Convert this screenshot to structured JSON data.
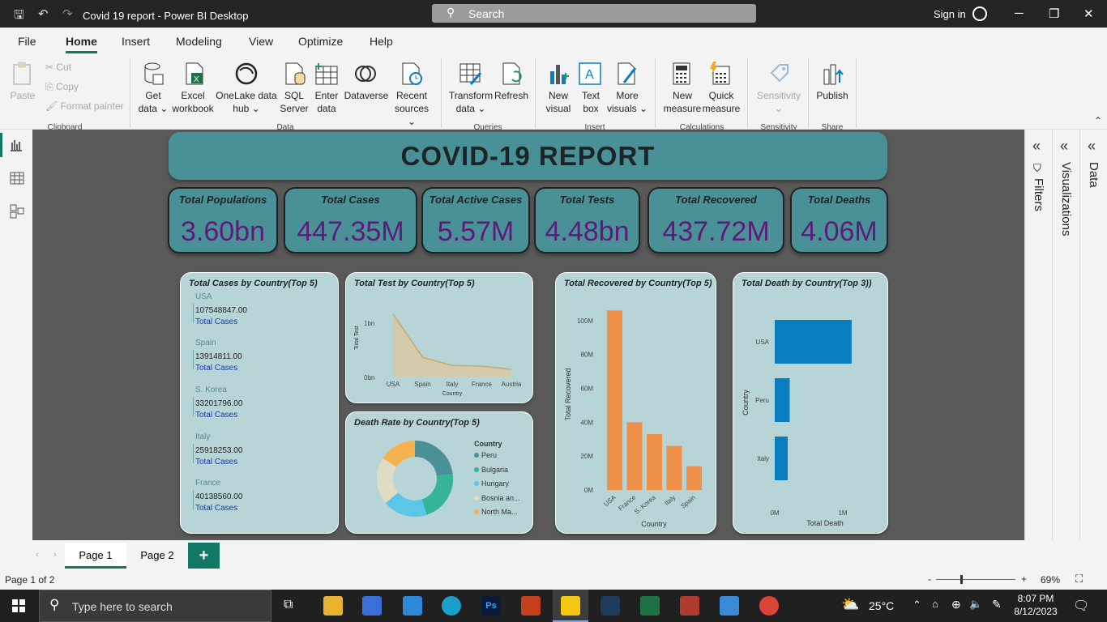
{
  "titlebar": {
    "title": "Covid 19 report - Power BI Desktop",
    "search": "Search",
    "signin": "Sign in"
  },
  "menu": {
    "file": "File",
    "home": "Home",
    "insert": "Insert",
    "modeling": "Modeling",
    "view": "View",
    "optimize": "Optimize",
    "help": "Help"
  },
  "ribbon": {
    "paste": "Paste",
    "cut": "Cut",
    "copy": "Copy",
    "format_painter": "Format painter",
    "clipboard": "Clipboard",
    "get_data": [
      "Get",
      "data ⌄"
    ],
    "excel": [
      "Excel",
      "workbook"
    ],
    "onelake": [
      "OneLake data",
      "hub ⌄"
    ],
    "sql": [
      "SQL",
      "Server"
    ],
    "enter": [
      "Enter",
      "data"
    ],
    "dataverse": [
      "Dataverse",
      ""
    ],
    "recent": [
      "Recent",
      "sources ⌄"
    ],
    "data_group": "Data",
    "transform": [
      "Transform",
      "data ⌄"
    ],
    "refresh": [
      "Refresh",
      ""
    ],
    "queries": "Queries",
    "new_visual": [
      "New",
      "visual"
    ],
    "text_box": [
      "Text",
      "box"
    ],
    "more_visuals": [
      "More",
      "visuals ⌄"
    ],
    "insert_group": "Insert",
    "new_measure": [
      "New",
      "measure"
    ],
    "quick_measure": [
      "Quick",
      "measure"
    ],
    "calculations": "Calculations",
    "sensitivity": [
      "Sensitivity",
      "⌄"
    ],
    "sensitivity_group": "Sensitivity",
    "publish": [
      "Publish",
      ""
    ],
    "share": "Share"
  },
  "panes": {
    "filters": "Filters",
    "visualizations": "Visualizations",
    "data": "Data"
  },
  "report": {
    "title": "COVID-19 REPORT",
    "kpis": [
      {
        "label": "Total Populations",
        "value": "3.60bn"
      },
      {
        "label": "Total Cases",
        "value": "447.35M"
      },
      {
        "label": "Total Active Cases",
        "value": "5.57M"
      },
      {
        "label": "Total Tests",
        "value": "4.48bn"
      },
      {
        "label": "Total Recovered",
        "value": "437.72M"
      },
      {
        "label": "Total Deaths",
        "value": "4.06M"
      }
    ],
    "cases_card": {
      "title": "Total Cases by Country(Top 5)",
      "measure": "Total Cases",
      "items": [
        {
          "country": "USA",
          "value": "107548847.00"
        },
        {
          "country": "Spain",
          "value": "13914811.00"
        },
        {
          "country": "S. Korea",
          "value": "33201796.00"
        },
        {
          "country": "Italy",
          "value": "25918253.00"
        },
        {
          "country": "France",
          "value": "40138560.00"
        }
      ]
    },
    "death_rate": {
      "title": "Death Rate by Country(Top 5)",
      "legend_title": "Country",
      "legend": [
        "Peru",
        "Bulgaria",
        "Hungary",
        "Bosnia an...",
        "North Ma..."
      ]
    }
  },
  "chart_data": [
    {
      "type": "area",
      "title": "Total Test by Country(Top 5)",
      "xlabel": "Country",
      "ylabel": "Total Test",
      "categories": [
        "USA",
        "Spain",
        "Italy",
        "France",
        "Austria"
      ],
      "values": [
        1170000000,
        370000000,
        220000000,
        210000000,
        150000000
      ],
      "ylim": [
        0,
        1300000000
      ],
      "yticks": [
        "0bn",
        "1bn"
      ]
    },
    {
      "type": "pie",
      "title": "Death Rate by Country(Top 5)",
      "categories": [
        "Peru",
        "Bulgaria",
        "Hungary",
        "Bosnia an...",
        "North Ma..."
      ],
      "values": [
        23,
        22,
        19,
        20,
        16
      ]
    },
    {
      "type": "bar",
      "title": "Total Recovered by Country(Top 5)",
      "xlabel": "Country",
      "ylabel": "Total Recovered",
      "categories": [
        "USA",
        "France",
        "S. Korea",
        "Italy",
        "Spain"
      ],
      "values": [
        106000000,
        40000000,
        33000000,
        26000000,
        14000000
      ],
      "ylim": [
        0,
        110000000
      ],
      "yticks": [
        "0M",
        "20M",
        "40M",
        "60M",
        "80M",
        "100M"
      ]
    },
    {
      "type": "bar",
      "orientation": "horizontal",
      "title": "Total Death by Country(Top 3))",
      "xlabel": "Total Death",
      "ylabel": "Country",
      "categories": [
        "USA",
        "Peru",
        "Italy"
      ],
      "values": [
        1130000,
        220000,
        190000
      ],
      "xlim": [
        0,
        1000000
      ],
      "xticks": [
        "0M",
        "1M"
      ]
    }
  ],
  "pages": {
    "page1": "Page 1",
    "page2": "Page 2",
    "add": "+"
  },
  "status": {
    "page_of": "Page 1 of 2",
    "zoom": "69%"
  },
  "taskbar": {
    "search": "Type here to search",
    "weather": "25°C",
    "time": "8:07 PM",
    "date": "8/12/2023"
  },
  "colors": {
    "kpi_bg": "#4a9197",
    "kpi_value": "#5e1a7a",
    "card_bg": "#b7d5d6",
    "recovered_bar": "#f0914a",
    "death_bar": "#0a7cc0",
    "donut": [
      "#4a9197",
      "#35b595",
      "#5bc6ea",
      "#e0dcc4",
      "#f5b24f"
    ]
  }
}
